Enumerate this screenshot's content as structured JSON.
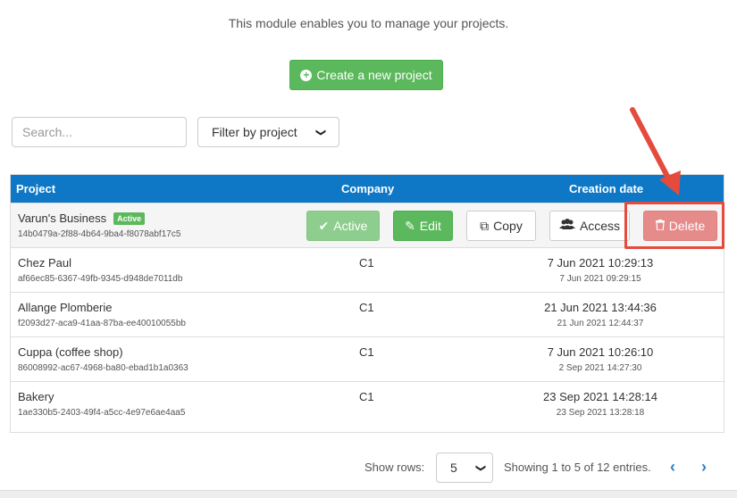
{
  "intro": "This module enables you to manage your projects.",
  "create_button": "Create a new project",
  "search": {
    "placeholder": "Search..."
  },
  "filter": {
    "selected": "Filter by project"
  },
  "table": {
    "headers": {
      "project": "Project",
      "company": "Company",
      "creation_date": "Creation date"
    },
    "rows": [
      {
        "name": "Varun's Business",
        "badge": "Active",
        "uuid": "14b0479a-2f88-4b64-9ba4-f8078abf17c5",
        "company": "",
        "date": "",
        "date_sub": ""
      },
      {
        "name": "Chez Paul",
        "uuid": "af66ec85-6367-49fb-9345-d948de7011db",
        "company": "C1",
        "date": "7 Jun 2021 10:29:13",
        "date_sub": "7 Jun 2021 09:29:15"
      },
      {
        "name": "Allange Plomberie",
        "uuid": "f2093d27-aca9-41aa-87ba-ee40010055bb",
        "company": "C1",
        "date": "21 Jun 2021 13:44:36",
        "date_sub": "21 Jun 2021 12:44:37"
      },
      {
        "name": "Cuppa (coffee shop)",
        "uuid": "86008992-ac67-4968-ba80-ebad1b1a0363",
        "company": "C1",
        "date": "7 Jun 2021 10:26:10",
        "date_sub": "2 Sep 2021 14:27:30"
      },
      {
        "name": "Bakery",
        "uuid": "1ae330b5-2403-49f4-a5cc-4e97e6ae4aa5",
        "company": "C1",
        "date": "23 Sep 2021 14:28:14",
        "date_sub": "23 Sep 2021 13:28:18"
      }
    ],
    "actions": {
      "active": "Active",
      "edit": "Edit",
      "copy": "Copy",
      "access": "Access",
      "delete": "Delete"
    }
  },
  "footer": {
    "show_rows_label": "Show rows:",
    "rows_value": "5",
    "info": "Showing 1 to 5 of 12 entries."
  },
  "colors": {
    "primary": "#0f78c6",
    "success": "#5cb85c",
    "danger": "#e58c8a",
    "highlight": "#e54b3c"
  }
}
